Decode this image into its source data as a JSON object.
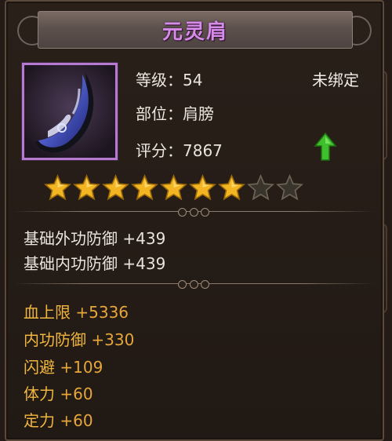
{
  "item": {
    "name": "元灵肩",
    "level_label": "等级：",
    "level": "54",
    "slot_label": "部位：",
    "slot": "肩膀",
    "score_label": "评分：",
    "score": "7867",
    "bind_status": "未绑定",
    "stars_filled": 7,
    "stars_total": 9
  },
  "base_attributes": [
    {
      "label": "基础外功防御",
      "value": "+439"
    },
    {
      "label": "基础内功防御",
      "value": "+439"
    }
  ],
  "extra_attributes": [
    {
      "label": "血上限",
      "value": "+5336"
    },
    {
      "label": "内功防御",
      "value": "+330"
    },
    {
      "label": "闪避",
      "value": "+109"
    },
    {
      "label": "体力",
      "value": "+60"
    },
    {
      "label": "定力",
      "value": "+60"
    }
  ],
  "colors": {
    "title": "#d78be8",
    "extra_attr": "#f0b63d",
    "upgrade_arrow": "#3fbf2c",
    "star": "#f3b521"
  }
}
